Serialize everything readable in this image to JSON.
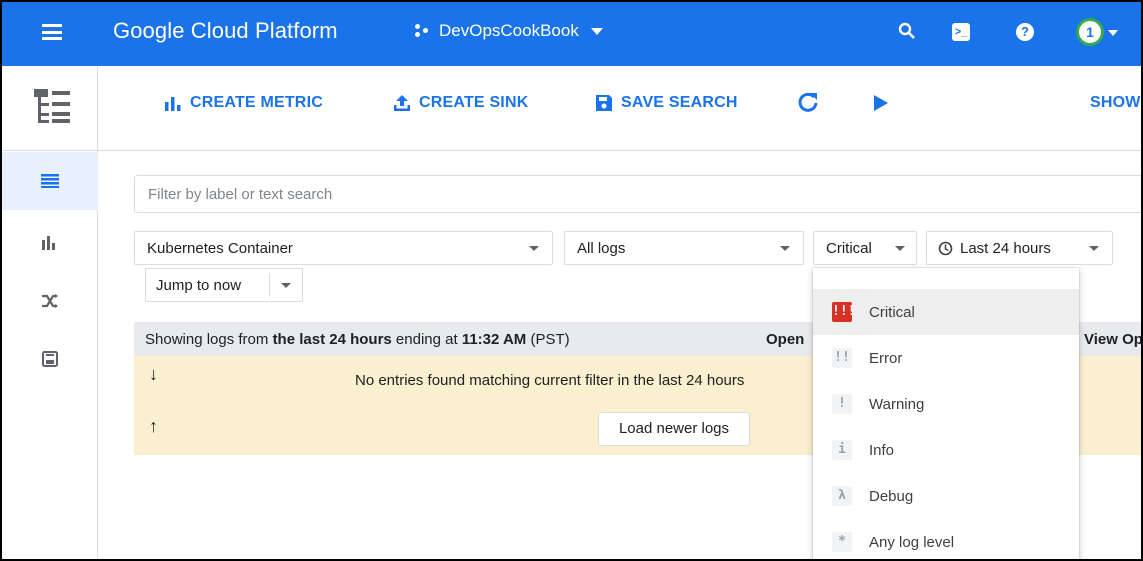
{
  "header": {
    "brand": "Google Cloud Platform",
    "project": "DevOpsCookBook",
    "avatar_number": "1"
  },
  "toolbar": {
    "create_metric": "CREATE METRIC",
    "create_sink": "CREATE SINK",
    "save_search": "SAVE SEARCH",
    "show": "SHOW"
  },
  "filters": {
    "search_placeholder": "Filter by label or text search",
    "resource": "Kubernetes Container",
    "log_name": "All logs",
    "severity": "Critical",
    "time_range": "Last 24 hours",
    "jump_to_now": "Jump to now"
  },
  "log_panel": {
    "showing_prefix": "Showing logs from ",
    "showing_bold": "the last 24 hours",
    "showing_mid": " ending at ",
    "showing_time": "11:32 AM",
    "showing_tz": " (PST)",
    "open_label": "Open",
    "view_label": "View Op",
    "no_entries": "No entries found matching current filter in the last 24 hours",
    "load_newer": "Load newer logs"
  },
  "severity_menu": [
    {
      "icon": "!!!",
      "label": "Critical",
      "selected": true
    },
    {
      "icon": "!!",
      "label": "Error",
      "selected": false
    },
    {
      "icon": "!",
      "label": "Warning",
      "selected": false
    },
    {
      "icon": "i",
      "label": "Info",
      "selected": false
    },
    {
      "icon": "λ",
      "label": "Debug",
      "selected": false
    },
    {
      "icon": "*",
      "label": "Any log level",
      "selected": false
    }
  ],
  "colors": {
    "brand_blue": "#1a73e8",
    "critical_red": "#d93025",
    "empty_banner": "#faefcf"
  }
}
